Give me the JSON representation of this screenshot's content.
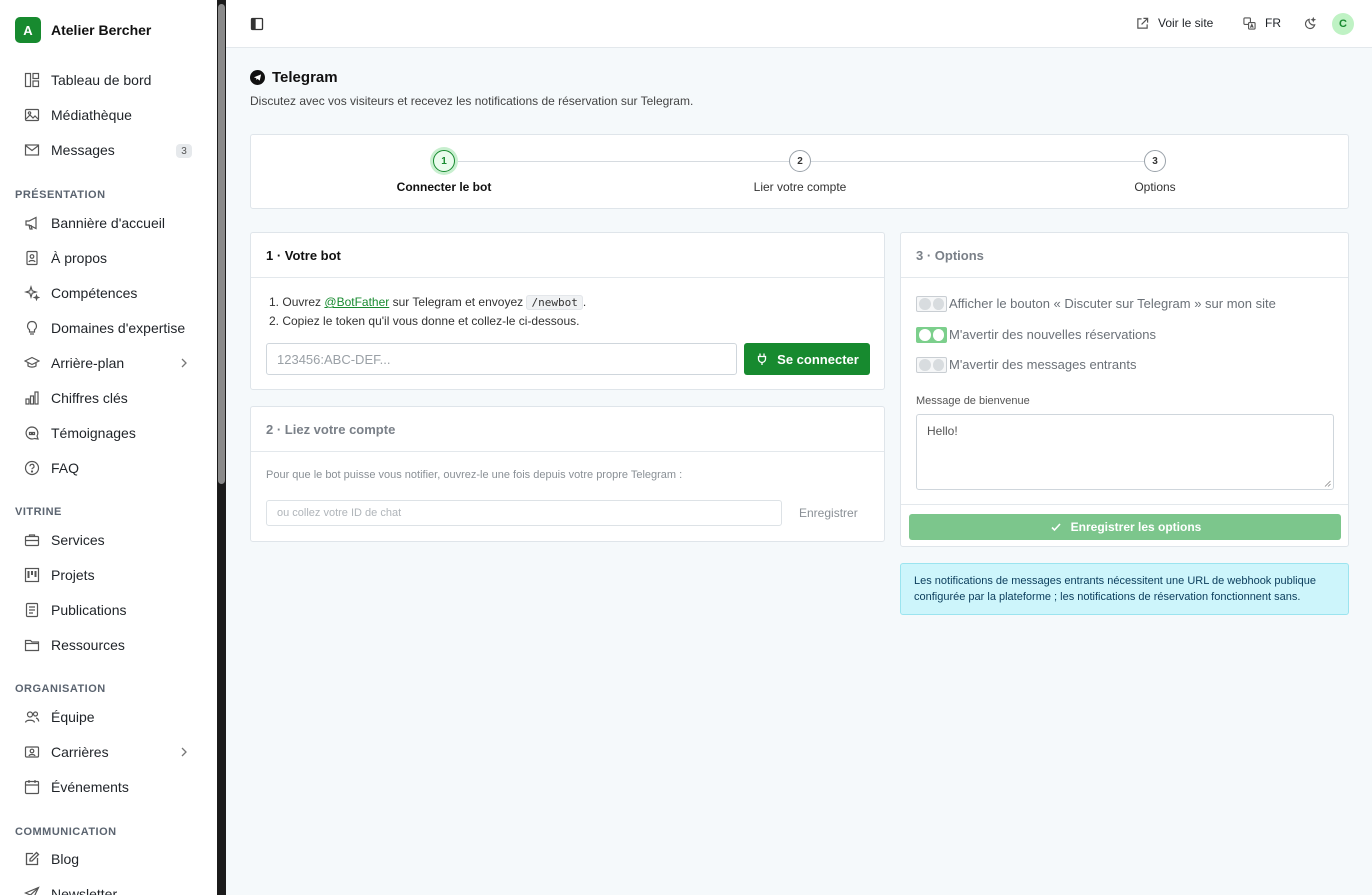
{
  "brand": {
    "initial": "A",
    "name": "Atelier Bercher"
  },
  "sidebar": {
    "main": [
      {
        "label": "Tableau de bord",
        "icon": "dashboard-icon"
      },
      {
        "label": "Médiathèque",
        "icon": "image-icon"
      },
      {
        "label": "Messages",
        "icon": "mail-icon",
        "badge": "3"
      }
    ],
    "sections": [
      {
        "title": "PRÉSENTATION",
        "items": [
          {
            "label": "Bannière d'accueil",
            "icon": "megaphone-icon"
          },
          {
            "label": "À propos",
            "icon": "contact-icon"
          },
          {
            "label": "Compétences",
            "icon": "sparkles-icon"
          },
          {
            "label": "Domaines d'expertise",
            "icon": "lightbulb-icon"
          },
          {
            "label": "Arrière-plan",
            "icon": "graduation-cap-icon",
            "chevron": true
          },
          {
            "label": "Chiffres clés",
            "icon": "bar-chart-icon"
          },
          {
            "label": "Témoignages",
            "icon": "quote-icon"
          },
          {
            "label": "FAQ",
            "icon": "help-circle-icon"
          }
        ]
      },
      {
        "title": "VITRINE",
        "items": [
          {
            "label": "Services",
            "icon": "briefcase-icon"
          },
          {
            "label": "Projets",
            "icon": "kanban-icon"
          },
          {
            "label": "Publications",
            "icon": "document-icon"
          },
          {
            "label": "Ressources",
            "icon": "folder-icon"
          }
        ]
      },
      {
        "title": "ORGANISATION",
        "items": [
          {
            "label": "Équipe",
            "icon": "users-icon"
          },
          {
            "label": "Carrières",
            "icon": "id-card-icon",
            "chevron": true
          },
          {
            "label": "Événements",
            "icon": "calendar-icon"
          }
        ]
      },
      {
        "title": "COMMUNICATION",
        "items": [
          {
            "label": "Blog",
            "icon": "edit-icon"
          },
          {
            "label": "Newsletter",
            "icon": "send-icon"
          }
        ]
      }
    ]
  },
  "topbar": {
    "view_site": "Voir le site",
    "language": "FR",
    "avatar": "C"
  },
  "page": {
    "title": "Telegram",
    "subtitle": "Discutez avec vos visiteurs et recevez les notifications de réservation sur Telegram."
  },
  "stepper": {
    "steps": [
      {
        "number": "1",
        "label": "Connecter le bot",
        "active": true
      },
      {
        "number": "2",
        "label": "Lier votre compte",
        "active": false
      },
      {
        "number": "3",
        "label": "Options",
        "active": false
      }
    ]
  },
  "bot_card": {
    "title": "1 · Votre bot",
    "line1_num": "1.",
    "line1_prefix": "Ouvrez",
    "line1_link": "@BotFather",
    "line1_mid": "sur Telegram et envoyez",
    "line1_code": "/newbot",
    "line1_end": ".",
    "line2": "2. Copiez le token qu'il vous donne et collez-le ci-dessous.",
    "token_placeholder": "123456:ABC-DEF...",
    "connect_label": "Se connecter"
  },
  "link_card": {
    "title": "2 · Liez votre compte",
    "description": "Pour que le bot puisse vous notifier, ouvrez-le une fois depuis votre propre Telegram :",
    "chat_id_placeholder": "ou collez votre ID de chat",
    "save_label": "Enregistrer"
  },
  "options_card": {
    "title": "3 · Options",
    "toggles": [
      {
        "label": "Afficher le bouton « Discuter sur Telegram » sur mon site",
        "on": false
      },
      {
        "label": "M'avertir des nouvelles réservations",
        "on": true
      },
      {
        "label": "M'avertir des messages entrants",
        "on": false
      }
    ],
    "welcome_label": "Message de bienvenue",
    "welcome_value": "Hello!",
    "save_label": "Enregistrer les options"
  },
  "alert": {
    "text": "Les notifications de messages entrants nécessitent une URL de webhook publique configurée par la plateforme ; les notifications de réservation fonctionnent sans."
  },
  "colors": {
    "accent": "#178a2f",
    "alert_bg": "#cdf5fb"
  }
}
